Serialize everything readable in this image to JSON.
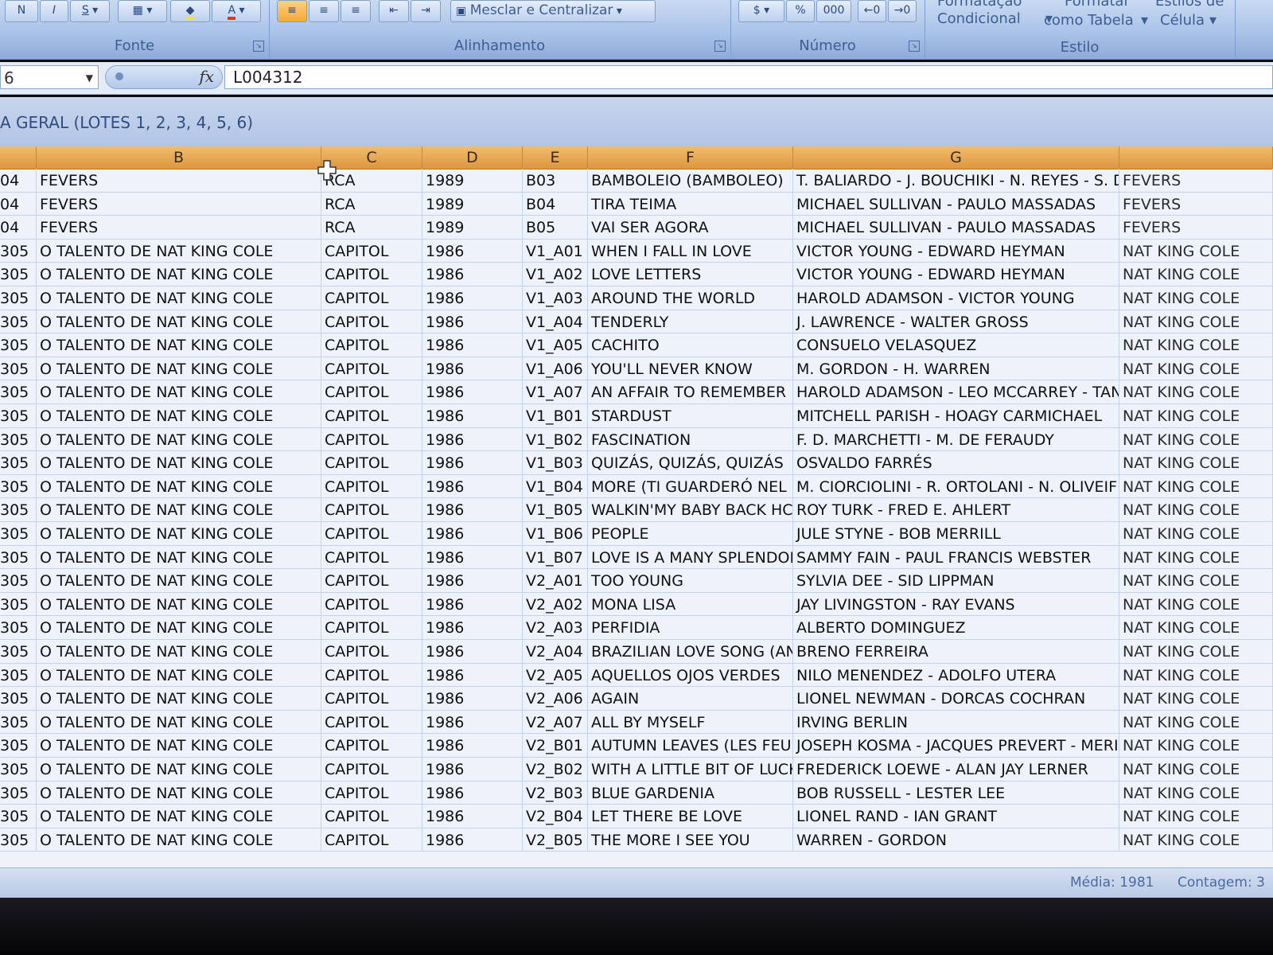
{
  "ribbon": {
    "groups": [
      {
        "label": "Fonte"
      },
      {
        "label": "Alinhamento"
      },
      {
        "label": "Número"
      },
      {
        "label": "Estilo"
      }
    ],
    "merge_center_label": "Mesclar e Centralizar",
    "conditional_format": [
      "Formatação",
      "Condicional"
    ],
    "format_as_table": [
      "Formatar",
      "como Tabela"
    ],
    "cell_styles": [
      "Estilos de",
      "Célula"
    ],
    "percent_symbol": "%",
    "thousands_symbol": "000"
  },
  "formula_bar": {
    "name_box": "6",
    "fx": "fx",
    "value": "L004312"
  },
  "sheet_title": "A GERAL (LOTES 1, 2, 3, 4, 5, 6)",
  "columns": [
    "B",
    "C",
    "D",
    "E",
    "F",
    "G"
  ],
  "rows": [
    [
      "04",
      "FEVERS",
      "RCA",
      "1989",
      "B03",
      "BAMBOLEIO (BAMBOLEO)",
      "T. BALIARDO - J. BOUCHIKI - N. REYES - S. D",
      "FEVERS"
    ],
    [
      "04",
      "FEVERS",
      "RCA",
      "1989",
      "B04",
      "TIRA TEIMA",
      "MICHAEL SULLIVAN - PAULO MASSADAS",
      "FEVERS"
    ],
    [
      "04",
      "FEVERS",
      "RCA",
      "1989",
      "B05",
      "VAI SER AGORA",
      "MICHAEL SULLIVAN - PAULO MASSADAS",
      "FEVERS"
    ],
    [
      "305",
      "O TALENTO DE NAT KING COLE",
      "CAPITOL",
      "1986",
      "V1_A01",
      "WHEN I FALL IN LOVE",
      "VICTOR YOUNG - EDWARD HEYMAN",
      "NAT KING COLE"
    ],
    [
      "305",
      "O TALENTO DE NAT KING COLE",
      "CAPITOL",
      "1986",
      "V1_A02",
      "LOVE LETTERS",
      "VICTOR YOUNG - EDWARD HEYMAN",
      "NAT KING COLE"
    ],
    [
      "305",
      "O TALENTO DE NAT KING COLE",
      "CAPITOL",
      "1986",
      "V1_A03",
      "AROUND THE WORLD",
      "HAROLD ADAMSON - VICTOR YOUNG",
      "NAT KING COLE"
    ],
    [
      "305",
      "O TALENTO DE NAT KING COLE",
      "CAPITOL",
      "1986",
      "V1_A04",
      "TENDERLY",
      "J. LAWRENCE - WALTER GROSS",
      "NAT KING COLE"
    ],
    [
      "305",
      "O TALENTO DE NAT KING COLE",
      "CAPITOL",
      "1986",
      "V1_A05",
      "CACHITO",
      "CONSUELO VELASQUEZ",
      "NAT KING COLE"
    ],
    [
      "305",
      "O TALENTO DE NAT KING COLE",
      "CAPITOL",
      "1986",
      "V1_A06",
      "YOU'LL NEVER KNOW",
      "M. GORDON - H. WARREN",
      "NAT KING COLE"
    ],
    [
      "305",
      "O TALENTO DE NAT KING COLE",
      "CAPITOL",
      "1986",
      "V1_A07",
      "AN AFFAIR TO REMEMBER",
      "HAROLD ADAMSON - LEO MCCARREY - TAN",
      "NAT KING COLE"
    ],
    [
      "305",
      "O TALENTO DE NAT KING COLE",
      "CAPITOL",
      "1986",
      "V1_B01",
      "STARDUST",
      "MITCHELL PARISH - HOAGY CARMICHAEL",
      "NAT KING COLE"
    ],
    [
      "305",
      "O TALENTO DE NAT KING COLE",
      "CAPITOL",
      "1986",
      "V1_B02",
      "FASCINATION",
      "F. D. MARCHETTI - M. DE FERAUDY",
      "NAT KING COLE"
    ],
    [
      "305",
      "O TALENTO DE NAT KING COLE",
      "CAPITOL",
      "1986",
      "V1_B03",
      "QUIZÁS, QUIZÁS, QUIZÁS",
      "OSVALDO FARRÉS",
      "NAT KING COLE"
    ],
    [
      "305",
      "O TALENTO DE NAT KING COLE",
      "CAPITOL",
      "1986",
      "V1_B04",
      "MORE (TI GUARDERÓ NEL (",
      "M. CIORCIOLINI - R. ORTOLANI - N. OLIVEIF",
      "NAT KING COLE"
    ],
    [
      "305",
      "O TALENTO DE NAT KING COLE",
      "CAPITOL",
      "1986",
      "V1_B05",
      "WALKIN'MY BABY BACK HC",
      "ROY TURK - FRED E. AHLERT",
      "NAT KING COLE"
    ],
    [
      "305",
      "O TALENTO DE NAT KING COLE",
      "CAPITOL",
      "1986",
      "V1_B06",
      "PEOPLE",
      "JULE STYNE - BOB MERRILL",
      "NAT KING COLE"
    ],
    [
      "305",
      "O TALENTO DE NAT KING COLE",
      "CAPITOL",
      "1986",
      "V1_B07",
      "LOVE IS A MANY SPLENDOF",
      "SAMMY FAIN - PAUL FRANCIS WEBSTER",
      "NAT KING COLE"
    ],
    [
      "305",
      "O TALENTO DE NAT KING COLE",
      "CAPITOL",
      "1986",
      "V2_A01",
      "TOO YOUNG",
      "SYLVIA DEE - SID LIPPMAN",
      "NAT KING COLE"
    ],
    [
      "305",
      "O TALENTO DE NAT KING COLE",
      "CAPITOL",
      "1986",
      "V2_A02",
      "MONA LISA",
      "JAY LIVINGSTON - RAY EVANS",
      "NAT KING COLE"
    ],
    [
      "305",
      "O TALENTO DE NAT KING COLE",
      "CAPITOL",
      "1986",
      "V2_A03",
      "PERFIDIA",
      "ALBERTO DOMINGUEZ",
      "NAT KING COLE"
    ],
    [
      "305",
      "O TALENTO DE NAT KING COLE",
      "CAPITOL",
      "1986",
      "V2_A04",
      "BRAZILIAN LOVE SONG (AN",
      "BRENO FERREIRA",
      "NAT KING COLE"
    ],
    [
      "305",
      "O TALENTO DE NAT KING COLE",
      "CAPITOL",
      "1986",
      "V2_A05",
      "AQUELLOS OJOS VERDES",
      "NILO MENENDEZ - ADOLFO UTERA",
      "NAT KING COLE"
    ],
    [
      "305",
      "O TALENTO DE NAT KING COLE",
      "CAPITOL",
      "1986",
      "V2_A06",
      "AGAIN",
      "LIONEL NEWMAN - DORCAS COCHRAN",
      "NAT KING COLE"
    ],
    [
      "305",
      "O TALENTO DE NAT KING COLE",
      "CAPITOL",
      "1986",
      "V2_A07",
      "ALL BY MYSELF",
      "IRVING BERLIN",
      "NAT KING COLE"
    ],
    [
      "305",
      "O TALENTO DE NAT KING COLE",
      "CAPITOL",
      "1986",
      "V2_B01",
      "AUTUMN LEAVES (LES FEUII",
      "JOSEPH KOSMA - JACQUES PREVERT - MERI",
      "NAT KING COLE"
    ],
    [
      "305",
      "O TALENTO DE NAT KING COLE",
      "CAPITOL",
      "1986",
      "V2_B02",
      "WITH A LITTLE BIT OF LUCK",
      "FREDERICK LOEWE - ALAN JAY LERNER",
      "NAT KING COLE"
    ],
    [
      "305",
      "O TALENTO DE NAT KING COLE",
      "CAPITOL",
      "1986",
      "V2_B03",
      "BLUE GARDENIA",
      "BOB RUSSELL - LESTER LEE",
      "NAT KING COLE"
    ],
    [
      "305",
      "O TALENTO DE NAT KING COLE",
      "CAPITOL",
      "1986",
      "V2_B04",
      "LET THERE BE LOVE",
      "LIONEL RAND - IAN GRANT",
      "NAT KING COLE"
    ],
    [
      "305",
      "O TALENTO DE NAT KING COLE",
      "CAPITOL",
      "1986",
      "V2_B05",
      "THE MORE I SEE YOU",
      "WARREN - GORDON",
      "NAT KING COLE"
    ]
  ],
  "status_bar": {
    "media": "Média: 1981",
    "count": "Contagem: 3"
  },
  "colors": {
    "column_header": "#e3a24f",
    "ribbon": "#aac3e8",
    "grid": "#eef2fa"
  }
}
